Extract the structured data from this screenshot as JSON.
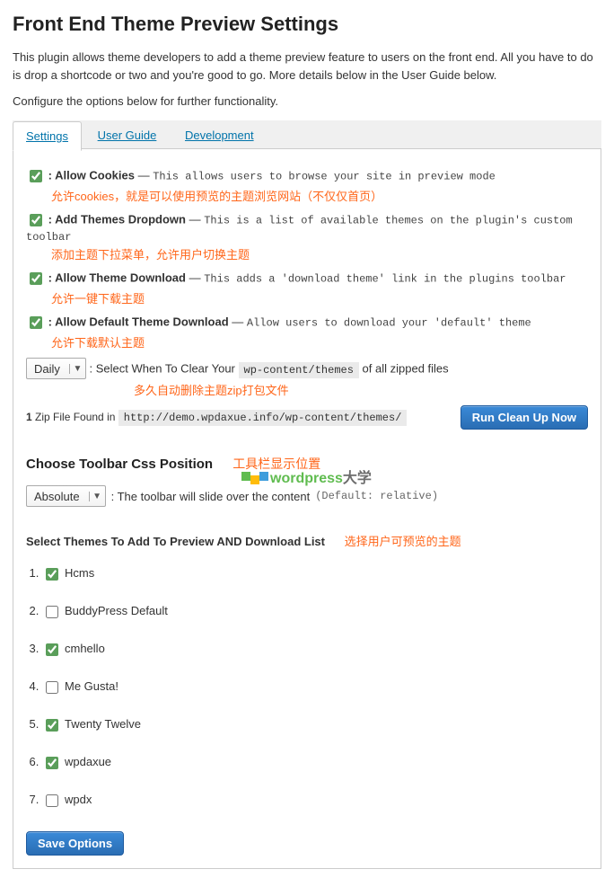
{
  "page_title": "Front End Theme Preview Settings",
  "description": "This plugin allows theme developers to add a theme preview feature to users on the front end. All you have to do is drop a shortcode or two and you're good to go. More details below in the User Guide below.",
  "configure_text": "Configure the options below for further functionality.",
  "tabs": {
    "settings": "Settings",
    "user_guide": "User Guide",
    "development": "Development"
  },
  "options": {
    "allow_cookies": {
      "label": ": Allow Cookies",
      "dash": "—",
      "desc": "This allows users to browse your site in preview mode",
      "anno": "允许cookies，就是可以使用预览的主题浏览网站（不仅仅首页）",
      "checked": true
    },
    "add_dropdown": {
      "label": ": Add Themes Dropdown",
      "dash": "—",
      "desc": "This is a list of available themes on the plugin's custom toolbar",
      "anno": "添加主题下拉菜单，允许用户切换主题",
      "checked": true
    },
    "theme_download": {
      "label": ": Allow Theme Download",
      "dash": "—",
      "desc": "This adds a 'download theme' link in the plugins toolbar",
      "anno": "允许一键下载主题",
      "checked": true
    },
    "default_download": {
      "label": ": Allow Default Theme Download",
      "dash": "—",
      "desc": "Allow users to download your 'default' theme",
      "anno": "允许下载默认主题",
      "checked": true
    }
  },
  "clear": {
    "select_value": "Daily",
    "label_prefix": ": Select When To Clear Your ",
    "path": "wp-content/themes",
    "label_suffix": " of all zipped files",
    "anno": "多久自动删除主题zip打包文件"
  },
  "cleanup": {
    "count_prefix": "1",
    "zip_text": " Zip File Found in ",
    "path": "http://demo.wpdaxue.info/wp-content/themes/",
    "button": "Run Clean Up Now"
  },
  "toolbar": {
    "title": "Choose Toolbar Css Position",
    "anno": "工具栏显示位置",
    "select_value": "Absolute",
    "desc": ": The toolbar will slide over the content ",
    "default": "(Default: relative)"
  },
  "watermark": {
    "text_green": "wordpress",
    "text_gray": "大学"
  },
  "themes": {
    "title": "Select Themes To Add To Preview AND Download List",
    "anno": "选择用户可预览的主题",
    "list": [
      {
        "label": "Hcms",
        "checked": true
      },
      {
        "label": "BuddyPress Default",
        "checked": false
      },
      {
        "label": "cmhello",
        "checked": true
      },
      {
        "label": "Me Gusta!",
        "checked": false
      },
      {
        "label": "Twenty Twelve",
        "checked": true
      },
      {
        "label": "wpdaxue",
        "checked": true
      },
      {
        "label": "wpdx",
        "checked": false
      }
    ]
  },
  "save_button": "Save Options"
}
